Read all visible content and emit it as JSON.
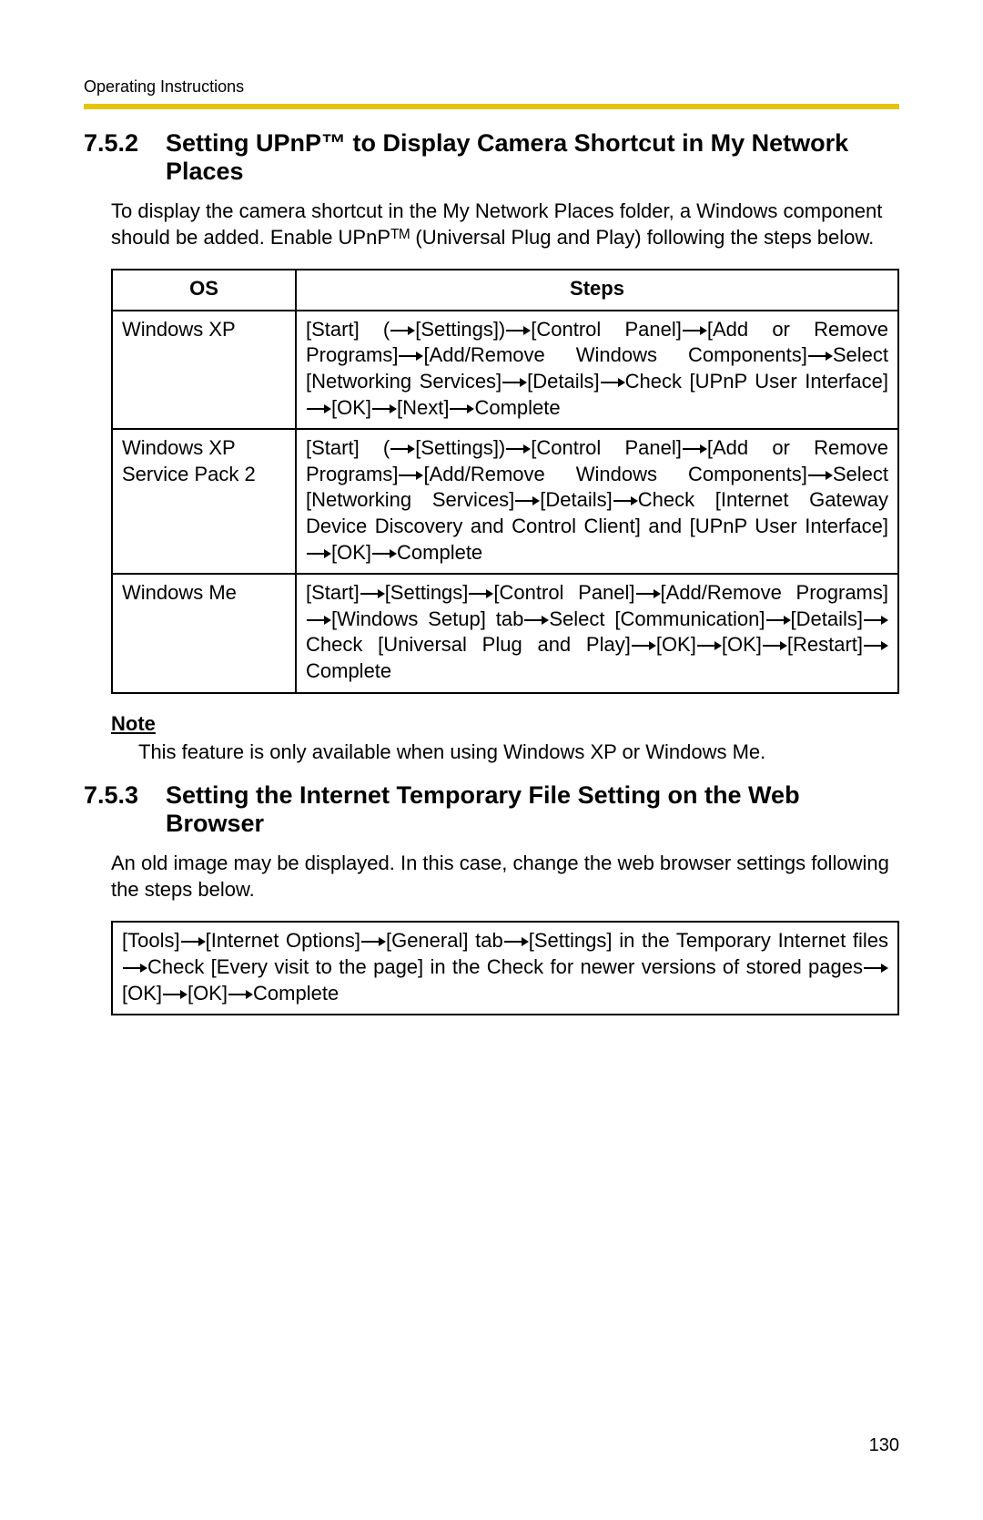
{
  "colors": {
    "accent": "#e6c40c"
  },
  "header": {
    "running": "Operating Instructions"
  },
  "section1": {
    "num": "7.5.2",
    "title": "Setting UPnP™ to Display Camera Shortcut in My Network Places",
    "intro_1": "To display the camera shortcut in the My Network Places folder, a Windows component should be added. Enable UPnP",
    "intro_tm": "TM",
    "intro_2": " (Universal Plug and Play) following the steps below."
  },
  "table": {
    "col_os": "OS",
    "col_steps": "Steps",
    "rows": [
      {
        "os": "Windows XP",
        "steps": [
          "[Start] (",
          "[Settings])",
          "[Control Panel]",
          "[Add or Remove Programs]",
          "[Add/Remove Windows Components]",
          "Select [Networking Services]",
          "[Details]",
          "Check [UPnP User Interface]",
          "[OK]",
          "[Next]",
          "Complete"
        ]
      },
      {
        "os": "Windows XP Service Pack 2",
        "steps": [
          "[Start] (",
          "[Settings])",
          "[Control Panel]",
          "[Add or Remove Programs]",
          "[Add/Remove Windows Components]",
          "Select [Networking Services]",
          "[Details]",
          "Check [Internet Gateway Device Discovery and Control Client] and [UPnP User Interface]",
          "[OK]",
          "Complete"
        ]
      },
      {
        "os": "Windows Me",
        "steps": [
          "[Start]",
          "[Settings]",
          "[Control Panel]",
          "[Add/Remove Programs]",
          "[Windows Setup] tab",
          "Select [Communication]",
          "[Details]",
          "Check [Universal Plug and Play]",
          "[OK]",
          "[OK]",
          "[Restart]",
          "Complete"
        ]
      }
    ]
  },
  "note": {
    "label": "Note",
    "body": "This feature is only available when using Windows XP or Windows Me."
  },
  "section2": {
    "num": "7.5.3",
    "title": "Setting the Internet Temporary File Setting on the Web Browser",
    "intro": "An old image may be displayed. In this case, change the web browser settings following the steps below.",
    "box_steps": [
      "[Tools]",
      "[Internet Options]",
      "[General] tab",
      "[Settings] in the Temporary Internet files",
      "Check [Every visit to the page] in the Check for newer versions of stored pages",
      "[OK]",
      "[OK]",
      "Complete"
    ]
  },
  "page_number": "130"
}
